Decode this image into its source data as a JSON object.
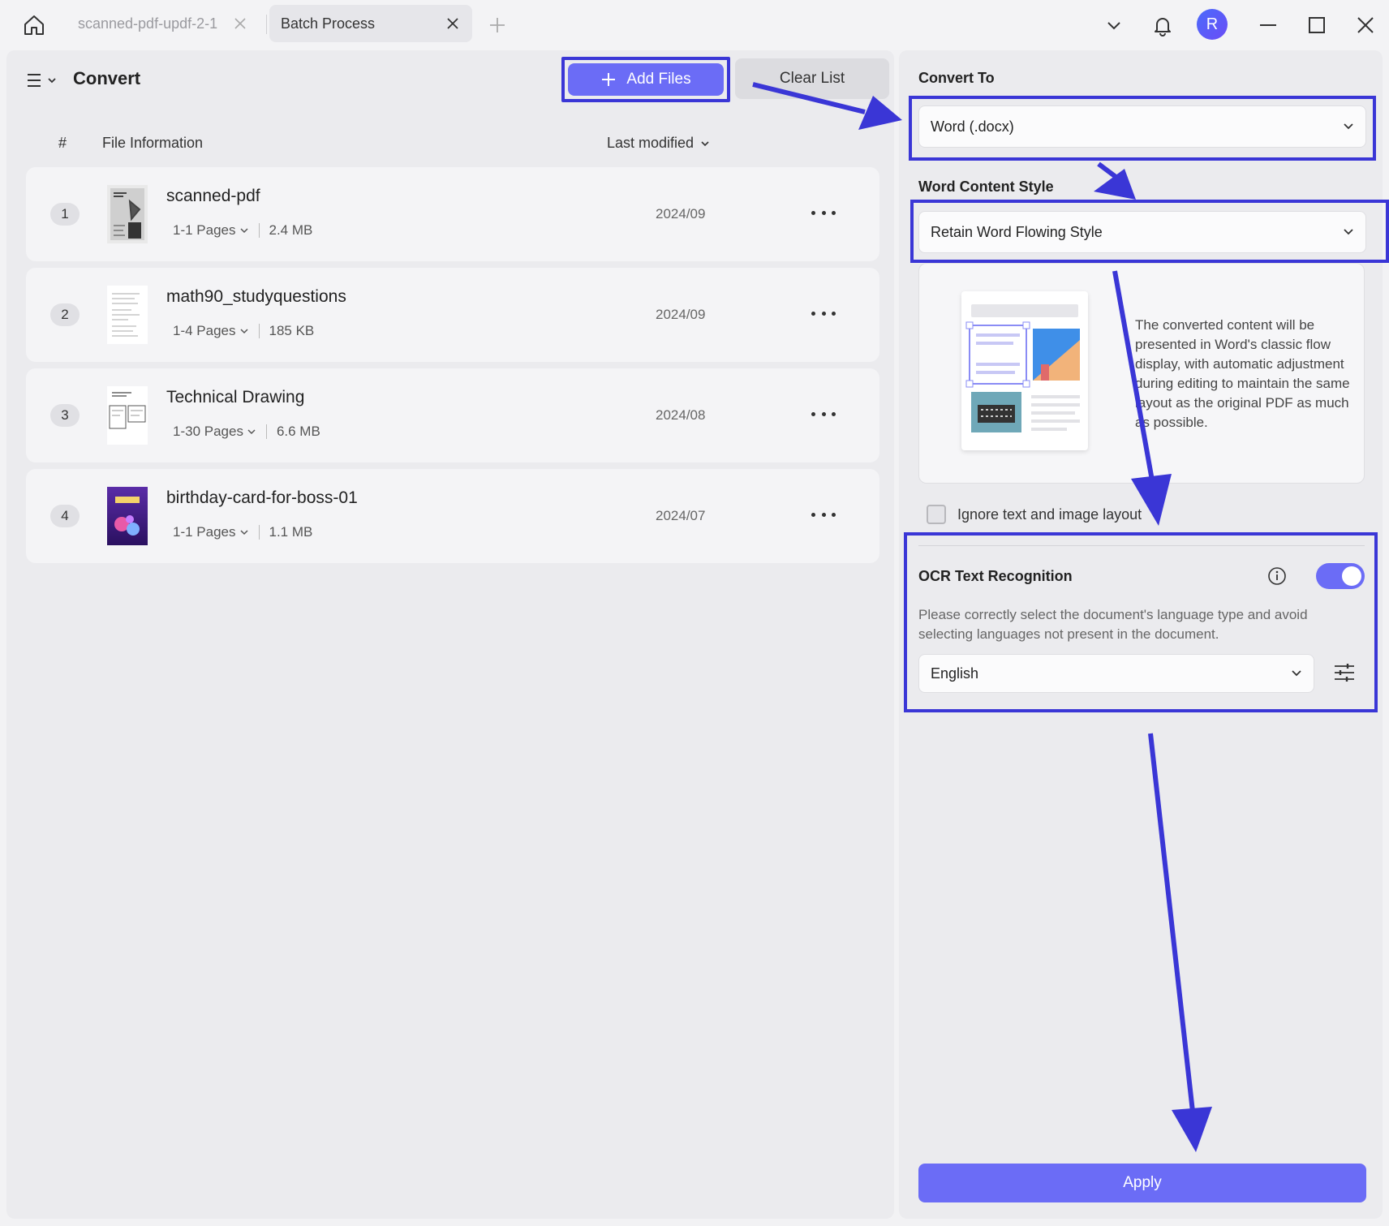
{
  "titlebar": {
    "tabs": [
      {
        "label": "scanned-pdf-updf-2-1",
        "active": false
      },
      {
        "label": "Batch Process",
        "active": true
      }
    ],
    "avatar_initial": "R"
  },
  "left": {
    "title": "Convert",
    "add_files_label": "Add Files",
    "clear_list_label": "Clear List",
    "columns": {
      "num": "#",
      "info": "File Information",
      "modified": "Last modified"
    },
    "files": [
      {
        "num": "1",
        "name": "scanned-pdf",
        "pages": "1-1 Pages",
        "size": "2.4 MB",
        "date": "2024/09"
      },
      {
        "num": "2",
        "name": "math90_studyquestions",
        "pages": "1-4 Pages",
        "size": "185 KB",
        "date": "2024/09"
      },
      {
        "num": "3",
        "name": "Technical Drawing",
        "pages": "1-30 Pages",
        "size": "6.6 MB",
        "date": "2024/08"
      },
      {
        "num": "4",
        "name": "birthday-card-for-boss-01",
        "pages": "1-1 Pages",
        "size": "1.1 MB",
        "date": "2024/07"
      }
    ]
  },
  "right": {
    "convert_to_label": "Convert To",
    "convert_to_value": "Word (.docx)",
    "content_style_label": "Word Content Style",
    "content_style_value": "Retain Word Flowing Style",
    "preview_description": "The converted content will be presented in Word's classic flow display, with automatic adjustment during editing to maintain the same layout as the original PDF as much as possible.",
    "ignore_layout_label": "Ignore text and image layout",
    "ignore_layout_checked": false,
    "ocr_label": "OCR Text Recognition",
    "ocr_enabled": true,
    "ocr_description": "Please correctly select the document's language type and avoid selecting languages not present in the document.",
    "ocr_language": "English",
    "apply_label": "Apply"
  },
  "colors": {
    "accent": "#6b6cf6",
    "annotation": "#3a36d6"
  }
}
